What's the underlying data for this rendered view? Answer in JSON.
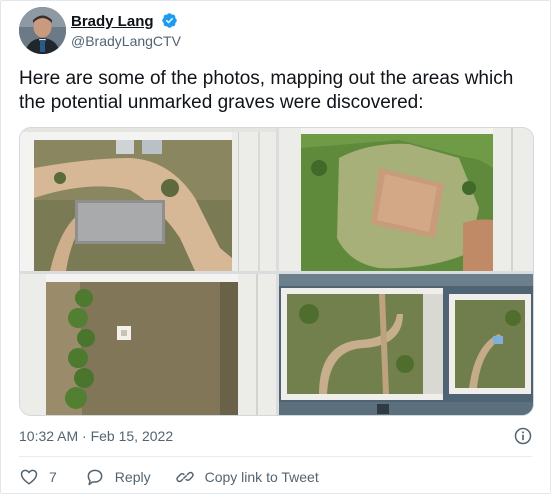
{
  "author": {
    "display_name": "Brady Lang",
    "handle": "@BradyLangCTV",
    "verified": true
  },
  "tweet": {
    "text": "Here are some of the photos, mapping out the areas which the potential unmarked graves were discovered:",
    "timestamp": "10:32 AM · Feb 15, 2022"
  },
  "media": {
    "photo_count": 4
  },
  "actions": {
    "like_count": "7",
    "reply_label": "Reply",
    "copy_link_label": "Copy link to Tweet"
  },
  "colors": {
    "text": "#0f1419",
    "secondary": "#536471",
    "verified_blue": "#1d9bf0",
    "border": "#cfd9de"
  },
  "icons": [
    "verified-badge-icon",
    "info-icon",
    "heart-icon",
    "reply-bubble-icon",
    "link-icon"
  ]
}
